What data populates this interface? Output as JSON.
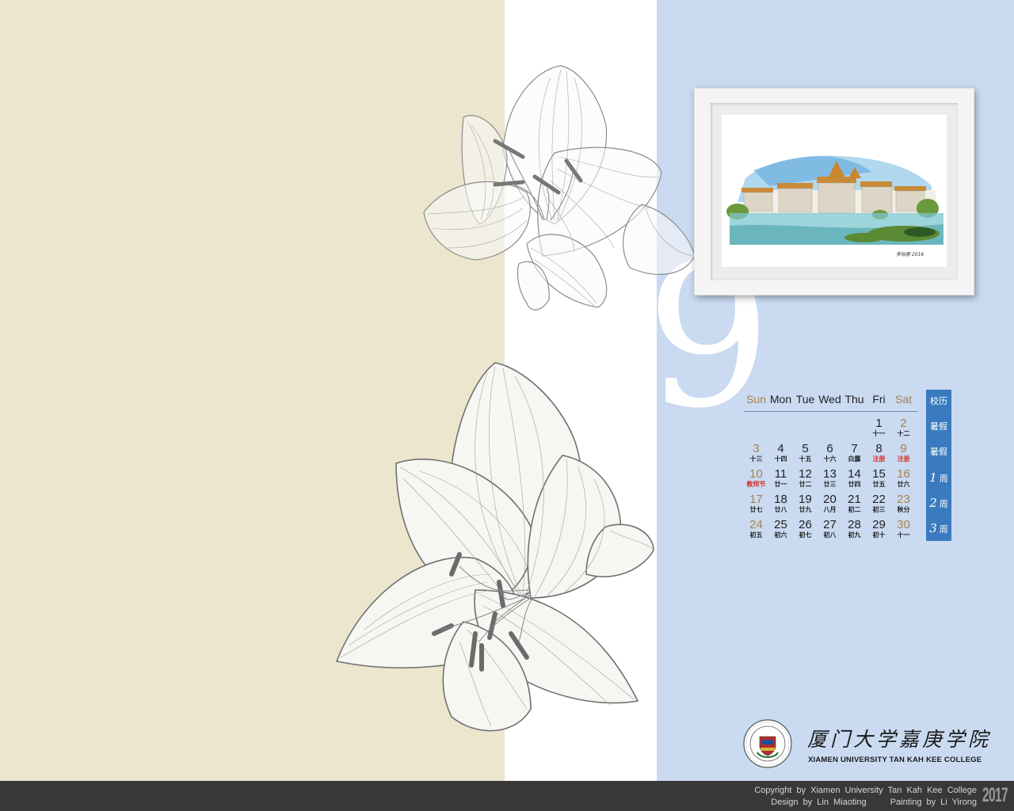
{
  "calendar": {
    "month": "9",
    "weekdays": [
      "Sun",
      "Mon",
      "Tue",
      "Wed",
      "Thu",
      "Fri",
      "Sat"
    ],
    "weeks": [
      [
        null,
        null,
        null,
        null,
        null,
        {
          "d": "1",
          "l": "十一"
        },
        {
          "d": "2",
          "l": "十二"
        }
      ],
      [
        {
          "d": "3",
          "l": "十三"
        },
        {
          "d": "4",
          "l": "十四"
        },
        {
          "d": "5",
          "l": "十五"
        },
        {
          "d": "6",
          "l": "十六"
        },
        {
          "d": "7",
          "l": "白露"
        },
        {
          "d": "8",
          "l": "注册",
          "red": true
        },
        {
          "d": "9",
          "l": "注册",
          "red": true
        }
      ],
      [
        {
          "d": "10",
          "l": "教师节",
          "red": true
        },
        {
          "d": "11",
          "l": "廿一"
        },
        {
          "d": "12",
          "l": "廿二"
        },
        {
          "d": "13",
          "l": "廿三"
        },
        {
          "d": "14",
          "l": "廿四"
        },
        {
          "d": "15",
          "l": "廿五"
        },
        {
          "d": "16",
          "l": "廿六"
        }
      ],
      [
        {
          "d": "17",
          "l": "廿七"
        },
        {
          "d": "18",
          "l": "廿八"
        },
        {
          "d": "19",
          "l": "廿九"
        },
        {
          "d": "20",
          "l": "八月"
        },
        {
          "d": "21",
          "l": "初二"
        },
        {
          "d": "22",
          "l": "初三"
        },
        {
          "d": "23",
          "l": "秋分"
        }
      ],
      [
        {
          "d": "24",
          "l": "初五"
        },
        {
          "d": "25",
          "l": "初六"
        },
        {
          "d": "26",
          "l": "初七"
        },
        {
          "d": "27",
          "l": "初八"
        },
        {
          "d": "28",
          "l": "初九"
        },
        {
          "d": "29",
          "l": "初十"
        },
        {
          "d": "30",
          "l": "十一"
        }
      ]
    ],
    "side_column": [
      {
        "text": "校历"
      },
      {
        "text": "暑假"
      },
      {
        "text": "暑假"
      },
      {
        "num": "1",
        "unit": "周"
      },
      {
        "num": "2",
        "unit": "周"
      },
      {
        "num": "3",
        "unit": "周"
      }
    ]
  },
  "college": {
    "name_cn": "厦门大学嘉庚学院",
    "name_en": "XIAMEN UNIVERSITY TAN KAH KEE COLLEGE"
  },
  "footer": {
    "copyright": "Copyright by Xiamen University Tan Kah Kee College",
    "design": "Design by Lin Miaoting",
    "painting": "Painting by Li Yirong",
    "year": "2017"
  },
  "colors": {
    "left_panel": "#ece6cf",
    "right_panel": "#c9daf1",
    "side_column": "#3a7bbf",
    "weekend_text": "#a8824e",
    "holiday_text": "#d0342c",
    "footer_bar": "#383838"
  }
}
